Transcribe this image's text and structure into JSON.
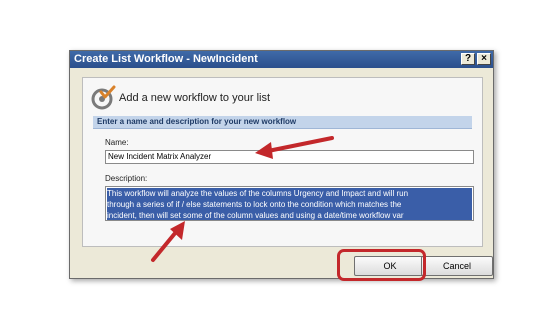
{
  "window": {
    "title": "Create List Workflow - NewIncident",
    "help_glyph": "?",
    "close_glyph": "×"
  },
  "wizard": {
    "heading": "Add a new workflow to your list",
    "section_title": "Enter a name and description for your new workflow",
    "icon": "workflow-icon"
  },
  "form": {
    "name_label": "Name:",
    "name_value": "New Incident Matrix Analyzer",
    "description_label": "Description:",
    "description_line1": "This workflow will analyze the values of the columns Urgency and Impact and will run",
    "description_line2": "through a series of if / else statements to lock onto the condition which matches the",
    "description_line3": "incident, then will set some of the column values and using a date/time workflow var"
  },
  "buttons": {
    "ok_label": "OK",
    "cancel_label": "Cancel"
  },
  "annotations": {
    "color": "#c3282b"
  }
}
